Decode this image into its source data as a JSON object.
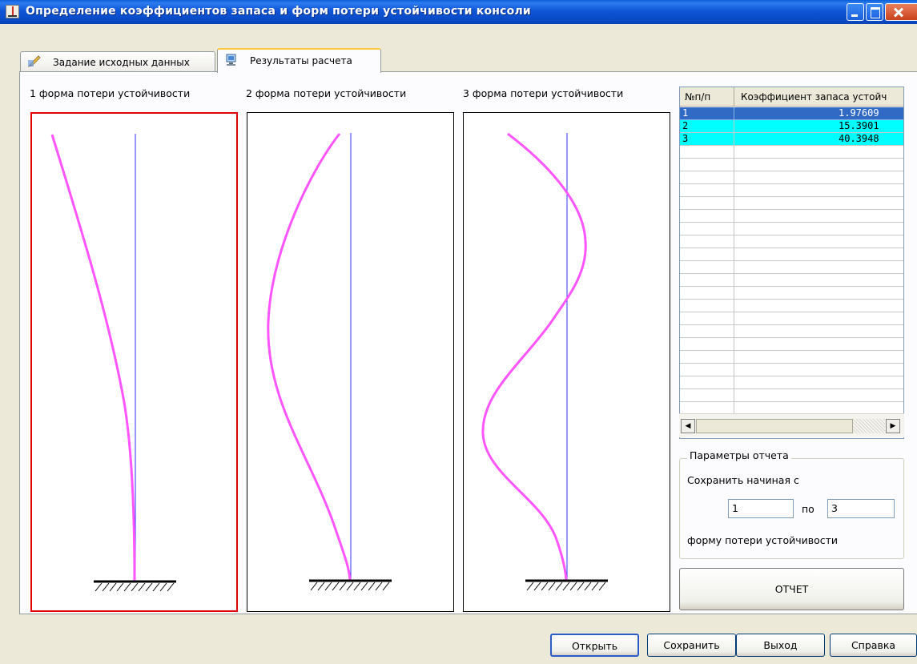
{
  "window": {
    "title": "Определение коэффициентов запаса и форм потери устойчивости консоли",
    "icon": "beam-app-icon",
    "controls": [
      "minimize-icon",
      "maximize-icon",
      "close-icon"
    ]
  },
  "tabs": [
    {
      "label": "Задание исходных данных",
      "icon": "edit-data-icon",
      "active": false
    },
    {
      "label": "Результаты расчета",
      "icon": "computer-results-icon",
      "active": true
    }
  ],
  "shapes": {
    "captions": [
      "1 форма потери устойчивости",
      "2 форма потери устойчивости",
      "3 форма потери устойчивости"
    ],
    "selected_index": 0,
    "colors": {
      "curve": "#FF55FF",
      "axis": "#3030FF",
      "selection": "#E00000",
      "support": "#000000"
    }
  },
  "table": {
    "columns": [
      "№п/п",
      "Коэффициент запаса устойч"
    ],
    "rows": [
      {
        "n": "1",
        "k": "1.97609"
      },
      {
        "n": "2",
        "k": "15.3901"
      },
      {
        "n": "3",
        "k": "40.3948"
      }
    ],
    "selected_row": 0,
    "row_highlight_color": "#00FFFF",
    "selection_color": "#316AC5"
  },
  "report_params": {
    "legend": "Параметры отчета",
    "save_from_label": "Сохранить начиная с",
    "from_value": "1",
    "to_label": "по",
    "to_value": "3",
    "suffix_label": "форму потери устойчивости",
    "report_button": "ОТЧЕТ"
  },
  "footer": {
    "open": "Открыть",
    "save": "Сохранить",
    "exit": "Выход",
    "help": "Справка"
  }
}
